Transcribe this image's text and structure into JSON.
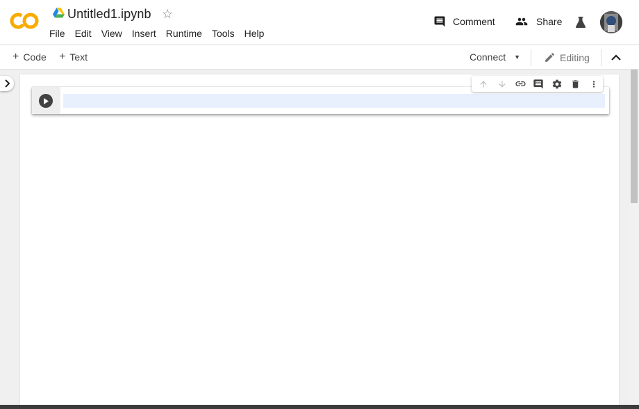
{
  "header": {
    "notebook_title": "Untitled1.ipynb",
    "menu": [
      "File",
      "Edit",
      "View",
      "Insert",
      "Runtime",
      "Tools",
      "Help"
    ],
    "comment_label": "Comment",
    "share_label": "Share"
  },
  "toolbar": {
    "code_label": "Code",
    "text_label": "Text",
    "connect_label": "Connect",
    "editing_label": "Editing"
  },
  "icons": {
    "logo": "colab-logo",
    "drive": "google-drive-icon",
    "star": "star-icon",
    "comment": "comment-icon",
    "share": "people-icon",
    "flask": "flask-icon",
    "collapse": "chevron-up-icon",
    "sidebar": "chevron-right-icon",
    "run": "play-icon",
    "cell_toolbar": [
      "arrow-up-icon",
      "arrow-down-icon",
      "link-icon",
      "comment-icon",
      "gear-icon",
      "trash-icon",
      "more-vert-icon"
    ]
  },
  "colors": {
    "logo_orange": "#F9AB00",
    "logo_yellow": "#E8710A",
    "editor_highlight": "#e8f0fe"
  }
}
